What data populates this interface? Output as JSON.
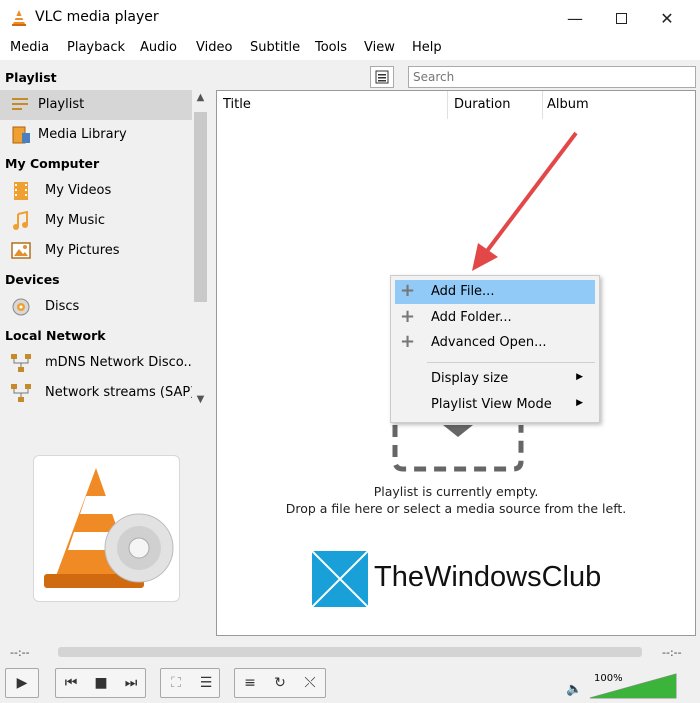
{
  "window": {
    "title": "VLC media player"
  },
  "menu": [
    "Media",
    "Playback",
    "Audio",
    "Video",
    "Subtitle",
    "Tools",
    "View",
    "Help"
  ],
  "sidebar": {
    "playlist_header": "Playlist",
    "playlist_item": "Playlist",
    "media_library": "Media Library",
    "my_computer_header": "My Computer",
    "my_videos": "My Videos",
    "my_music": "My Music",
    "my_pictures": "My Pictures",
    "devices_header": "Devices",
    "discs": "Discs",
    "local_network_header": "Local Network",
    "mdns": "mDNS Network Disco...",
    "network_streams": "Network streams (SAP)"
  },
  "search": {
    "placeholder": "Search"
  },
  "playlist": {
    "columns": {
      "title": "Title",
      "duration": "Duration",
      "album": "Album"
    },
    "empty_line1": "Playlist is currently empty.",
    "empty_line2": "Drop a file here or select a media source from the left."
  },
  "context_menu": {
    "add_file": "Add File...",
    "add_folder": "Add Folder...",
    "advanced_open": "Advanced Open...",
    "display_size": "Display size",
    "view_mode": "Playlist View Mode"
  },
  "watermark": "TheWindowsClub",
  "controls": {
    "time_elapsed": "--:--",
    "time_total": "--:--",
    "volume": "100%"
  },
  "colors": {
    "accent": "#e8732b",
    "highlight": "#91c9f7",
    "volume_fill": "#3cb43c"
  },
  "volume_level": 1.0
}
